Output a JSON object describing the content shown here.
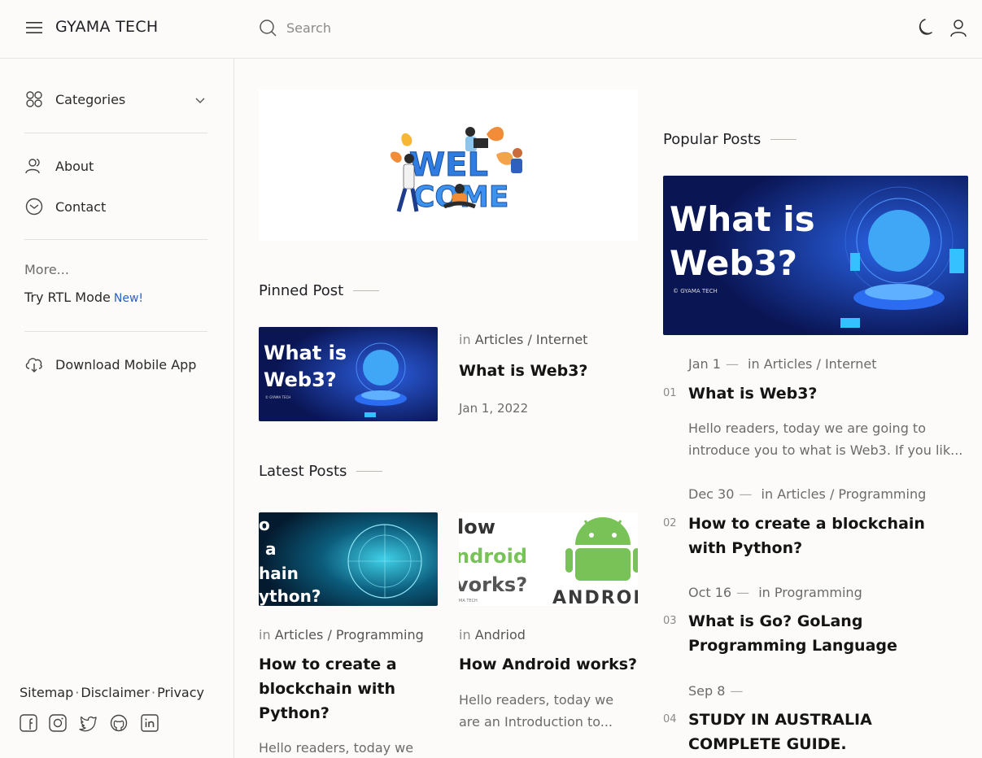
{
  "header": {
    "brand": "GYAMA TECH",
    "search_placeholder": "Search",
    "icons": [
      "menu-icon",
      "search-icon",
      "moon-icon",
      "user-icon"
    ]
  },
  "sidebar": {
    "categories_label": "Categories",
    "about_label": "About",
    "contact_label": "Contact",
    "more_label": "More...",
    "rtl_label": "Try RTL Mode",
    "rtl_badge": "New!",
    "download_label": "Download Mobile App",
    "footer_links": [
      "Sitemap",
      "Disclaimer",
      "Privacy"
    ],
    "social_icons": [
      "facebook-icon",
      "instagram-icon",
      "twitter-icon",
      "github-icon",
      "linkedin-icon"
    ]
  },
  "main": {
    "banner_text": "WELCOME",
    "pinned_title": "Pinned Post",
    "pinned_post": {
      "in": "in",
      "category": "Articles / Internet",
      "title": "What is Web3?",
      "date": "Jan 1, 2022",
      "thumb_text_1": "What is",
      "thumb_text_2": "Web3?",
      "thumb_credit": "© GYAMA TECH"
    },
    "latest_title": "Latest Posts",
    "latest_posts": [
      {
        "in": "in",
        "category": "Articles / Programming",
        "title": "How to create a blockchain with Python?",
        "excerpt": "Hello readers, today we",
        "thumb_lines": [
          "o",
          "a",
          "hain",
          "ython?"
        ]
      },
      {
        "in": "in",
        "category": "Andriod",
        "title": "How Android works?",
        "excerpt": "Hello readers, today we are an Introduction to...",
        "thumb_lines": [
          "low",
          "ndroid",
          "vorks?"
        ],
        "thumb_brand": "ANDROI",
        "thumb_credit": "MA TECH"
      }
    ]
  },
  "popular": {
    "title": "Popular Posts",
    "hero_text_1": "What is",
    "hero_text_2": "Web3?",
    "hero_credit": "© GYAMA TECH",
    "posts": [
      {
        "rank": "01",
        "date": "Jan 1",
        "in": "in",
        "category": "Articles / Internet",
        "title": "What is Web3?",
        "excerpt": "Hello readers, today we are going to introduce you to what is Web3. If you lik..."
      },
      {
        "rank": "02",
        "date": "Dec 30",
        "in": "in",
        "category": "Articles / Programming",
        "title": "How to create a blockchain with Python?",
        "excerpt": ""
      },
      {
        "rank": "03",
        "date": "Oct 16",
        "in": "in",
        "category": "Programming",
        "title": "What is Go? GoLang Programming Language",
        "excerpt": ""
      },
      {
        "rank": "04",
        "date": "Sep 8",
        "in": "",
        "category": "",
        "title": "STUDY IN AUSTRALIA COMPLETE GUIDE.",
        "excerpt": ""
      }
    ]
  },
  "colors": {
    "background": "#fcfbf9",
    "accent": "#2a62c4",
    "web3_bg": "#0b1a5c",
    "android_green": "#78c257"
  }
}
